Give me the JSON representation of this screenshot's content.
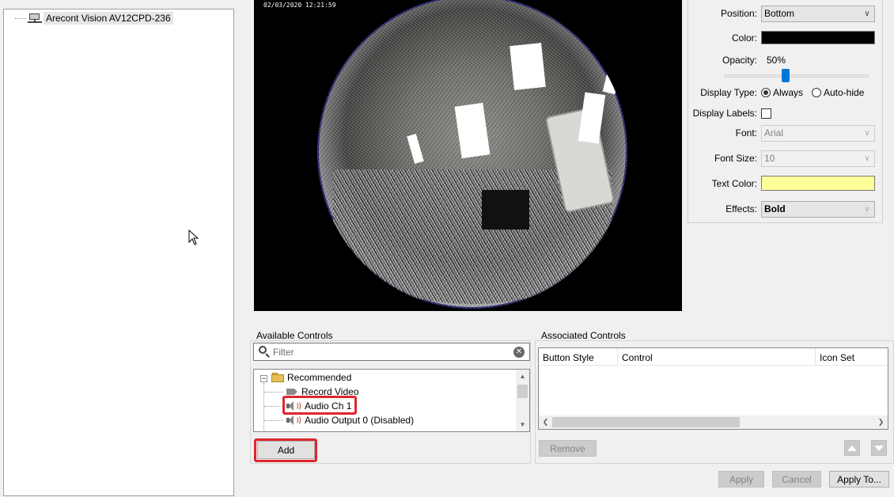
{
  "device_tree": {
    "items": [
      {
        "label": "Arecont Vision AV12CPD-236",
        "icon": "camera-device-icon"
      }
    ]
  },
  "video": {
    "timestamp": "02/03/2020 12:21:59"
  },
  "properties": {
    "position": {
      "label": "Position:",
      "value": "Bottom"
    },
    "color": {
      "label": "Color:",
      "value": "#000000"
    },
    "opacity": {
      "label": "Opacity:",
      "value": "50%",
      "fraction": 0.5
    },
    "display_type": {
      "label": "Display Type:",
      "options": [
        "Always",
        "Auto-hide"
      ],
      "selected": "Always"
    },
    "display_labels": {
      "label": "Display Labels:",
      "checked": false
    },
    "font": {
      "label": "Font:",
      "value": "Arial"
    },
    "font_size": {
      "label": "Font Size:",
      "value": "10"
    },
    "text_color": {
      "label": "Text Color:",
      "value": "#ffff99"
    },
    "effects": {
      "label": "Effects:",
      "value": "Bold"
    }
  },
  "available_controls": {
    "title": "Available Controls",
    "filter_placeholder": "Filter",
    "tree": {
      "group": "Recommended",
      "items": [
        {
          "label": "Record Video",
          "icon": "record-video-icon"
        },
        {
          "label": "Audio Ch 1",
          "icon": "speaker-icon"
        },
        {
          "label": "Audio Output 0 (Disabled)",
          "icon": "speaker-icon"
        }
      ]
    },
    "add_label": "Add"
  },
  "associated_controls": {
    "title": "Associated Controls",
    "columns": [
      "Button Style",
      "Control",
      "Icon Set"
    ],
    "remove_label": "Remove"
  },
  "footer": {
    "apply": "Apply",
    "cancel": "Cancel",
    "apply_to": "Apply To..."
  },
  "colors": {
    "highlight": "#e0262f",
    "accent": "#0078d7"
  }
}
